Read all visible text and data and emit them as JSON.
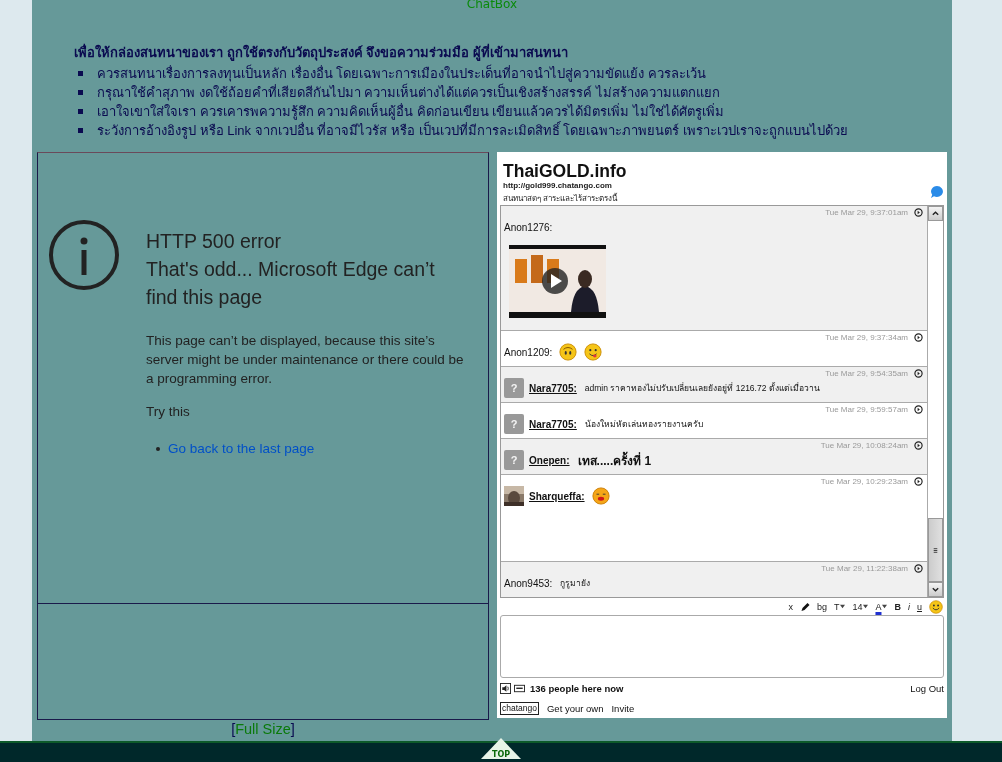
{
  "header": {
    "title": "ChatBox"
  },
  "rules": {
    "heading": "เพื่อให้กล่องสนทนาของเรา ถูกใช้ตรงกับวัตถุประสงค์ จึงขอความร่วมมือ ผู้ที่เข้ามาสนทนา",
    "items": [
      "ควรสนทนาเรื่องการลงทุนเป็นหลัก เรื่องอื่น โดยเฉพาะการเมืองในประเด็นที่อาจนำไปสู่ความขัดแย้ง ควรละเว้น",
      "กรุณาใช้คำสุภาพ งดใช้ถ้อยคำที่เสียดสีกันไปมา ความเห็นต่างได้แต่ควรเป็นเชิงสร้างสรรค์ ไม่สร้างความแตกแยก",
      "เอาใจเขาใส่ใจเรา ควรเคารพความรู้สึก ความคิดเห็นผู้อื่น คิดก่อนเขียน เขียนแล้วควรได้มิตรเพิ่ม ไม่ใช่ได้ศัตรูเพิ่ม",
      "ระวังการอ้างอิงรูป หรือ Link จากเวปอื่น ที่อาจมีไวรัส หรือ เป็นเวปที่มีการละเมิดสิทธิ์ โดยเฉพาะภาพยนตร์ เพราะเวปเราจะถูกแบนไปด้วย"
    ]
  },
  "error_page": {
    "title": "HTTP 500 error",
    "subtitle": "That's odd... Microsoft Edge can’t find this page",
    "message": "This page can’t be displayed, because this site’s server might be under maintenance or there could be a programming error.",
    "try_label": "Try this",
    "links": [
      "Go back to the last page"
    ],
    "full_size_link": "Full Size",
    "bracket_open": "[",
    "bracket_close": "]"
  },
  "chat": {
    "title": "ThaiGOLD.info",
    "url": "http://gold999.chatango.com",
    "description": "สนทนาสดๆ สาระและไร้สาระตรงนี้",
    "messages": [
      {
        "time": "Tue Mar 29, 9:37:01am",
        "name": "Anon1276:",
        "kind": "guest",
        "attachments": [
          {
            "kind": "video"
          }
        ]
      },
      {
        "time": "Tue Mar 29, 9:37:34am",
        "name": "Anon1209:",
        "kind": "guest",
        "attachments": [
          {
            "kind": "shocked"
          },
          {
            "kind": "tongue"
          }
        ]
      },
      {
        "time": "Tue Mar 29, 9:54:35am",
        "name": "Nara7705:",
        "kind": "member",
        "avatar_label": "?",
        "text": "admin ราคาทองไม่ปรับเปลี่ยนเลยยังอยู่ที่ 1216.72 ตั้งแต่เมื่อวาน"
      },
      {
        "time": "Tue Mar 29, 9:59:57am",
        "name": "Nara7705:",
        "kind": "member",
        "avatar_label": "?",
        "text": "น้องใหม่หัดเล่นทองรายงานครับ"
      },
      {
        "time": "Tue Mar 29, 10:08:24am",
        "name": "Onepen:",
        "kind": "member",
        "avatar_label": "?",
        "text": "เทส.....ครั้งที่   1",
        "bold": true
      },
      {
        "time": "Tue Mar 29, 10:29:23am",
        "name": "Sharqueffa:",
        "kind": "photo_member",
        "attachments": [
          {
            "kind": "kiss"
          }
        ]
      },
      {
        "time": "Tue Mar 29, 11:22:38am",
        "name": "Anon9453:",
        "kind": "guest",
        "text": "กูรูมายัง"
      }
    ],
    "toolbar": [
      "x",
      "bg",
      "T",
      "14",
      "A",
      "B",
      "i",
      "u"
    ],
    "people": "136 people here now",
    "logout": "Log Out",
    "brand": "chatango",
    "get_own": "Get your own",
    "invite": "Invite"
  },
  "footer": {
    "top_label": "TOP"
  }
}
